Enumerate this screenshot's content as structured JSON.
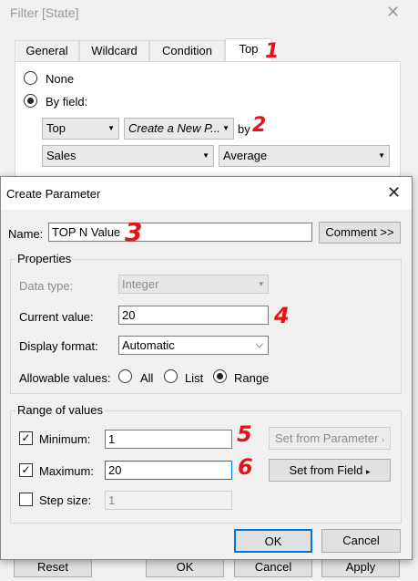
{
  "filter": {
    "title": "Filter [State]",
    "tabs": [
      "General",
      "Wildcard",
      "Condition",
      "Top"
    ],
    "none_label": "None",
    "by_field_label": "By field:",
    "top_combo": "Top",
    "param_combo": "Create a New P...",
    "by_label": "by",
    "field_combo": "Sales",
    "agg_combo": "Average",
    "bottom_buttons": [
      "Reset",
      "OK",
      "Cancel",
      "Apply"
    ]
  },
  "dialog": {
    "title": "Create Parameter",
    "name_label": "Name:",
    "name_value": "TOP N Value",
    "comment_button": "Comment >>",
    "properties_header": "Properties",
    "data_type_label": "Data type:",
    "data_type_value": "Integer",
    "current_value_label": "Current value:",
    "current_value": "20",
    "display_format_label": "Display format:",
    "display_format_value": "Automatic",
    "allowable_label": "Allowable values:",
    "allowable_options": [
      "All",
      "List",
      "Range"
    ],
    "range_header": "Range of values",
    "minimum_label": "Minimum:",
    "minimum_value": "1",
    "maximum_label": "Maximum:",
    "maximum_value": "20",
    "step_label": "Step size:",
    "step_value": "1",
    "set_from_parameter": "Set from Parameter",
    "set_from_field": "Set from Field",
    "ok": "OK",
    "cancel": "Cancel"
  },
  "annotations": [
    "1",
    "2",
    "3",
    "4",
    "5",
    "6"
  ],
  "colors": {
    "annotation": "#e8111b",
    "focus": "#0078d7"
  }
}
